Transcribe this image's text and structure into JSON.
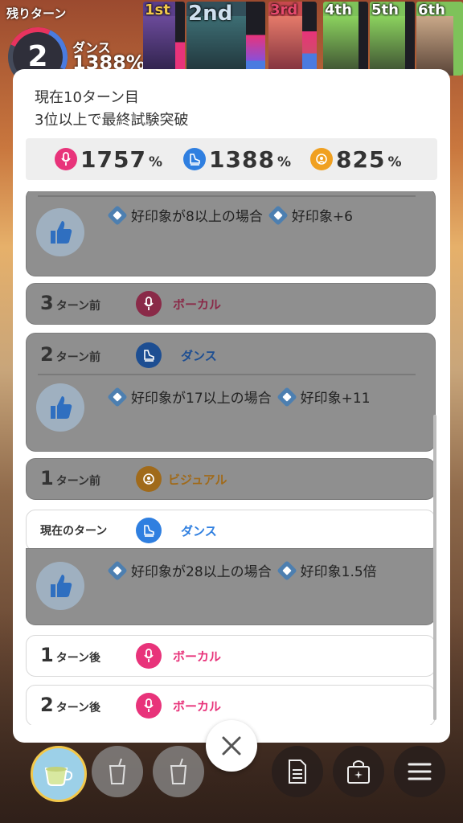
{
  "hud": {
    "remaining_label": "残りターン",
    "remaining_turns": "2",
    "current_type": "ダンス",
    "current_score": "1388%"
  },
  "ranks": [
    {
      "label": "1st",
      "color": "#f2c84b"
    },
    {
      "label": "2nd",
      "color": "#cfe0ef"
    },
    {
      "label": "3rd",
      "color": "#e84a6f"
    },
    {
      "label": "4th",
      "color": "#8bd25e"
    },
    {
      "label": "5th",
      "color": "#8bd25e"
    },
    {
      "label": "6th",
      "color": "#8bd25e"
    }
  ],
  "panel": {
    "line1": "現在10ターン目",
    "line2": "3位以上で最終試験突破"
  },
  "stats": {
    "vocal": {
      "value": "1757",
      "unit": "%",
      "color": "#e8337a",
      "icon": "microphone-icon"
    },
    "dance": {
      "value": "1388",
      "unit": "%",
      "color": "#2f7fe0",
      "icon": "dance-shoe-icon"
    },
    "visual": {
      "value": "825",
      "unit": "%",
      "color": "#f0a020",
      "icon": "visual-icon"
    }
  },
  "history": {
    "top_effect": {
      "condition": "好印象が8以上の場合",
      "result": "好印象+6"
    },
    "t3_before": {
      "num": "3",
      "suffix": "ターン前",
      "type": "ボーカル"
    },
    "t2_before": {
      "num": "2",
      "suffix": "ターン前",
      "type": "ダンス",
      "condition": "好印象が17以上の場合",
      "result": "好印象+11"
    },
    "t1_before": {
      "num": "1",
      "suffix": "ターン前",
      "type": "ビジュアル"
    },
    "current": {
      "label": "現在のターン",
      "type": "ダンス",
      "condition": "好印象が28以上の場合",
      "result": "好印象1.5倍"
    },
    "t1_after": {
      "num": "1",
      "suffix": "ターン後",
      "type": "ボーカル"
    },
    "t2_after": {
      "num": "2",
      "suffix": "ターン後",
      "type": "ボーカル"
    }
  },
  "colors": {
    "vocal": "#e8337a",
    "dance": "#2f7fe0",
    "visual": "#f0a020"
  }
}
